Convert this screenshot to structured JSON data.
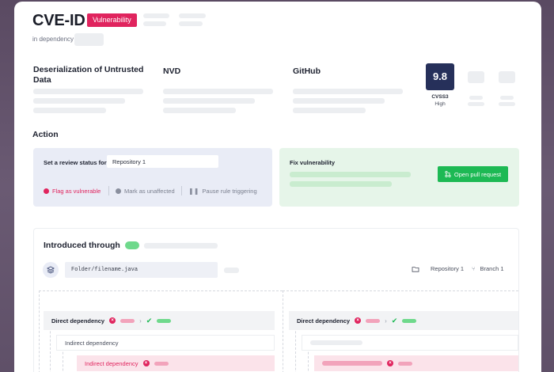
{
  "header": {
    "title": "CVE-ID",
    "badge": "Vulnerability",
    "subtitle": "in dependency"
  },
  "columns": [
    {
      "title": "Deserialization of Untrusted Data"
    },
    {
      "title": "NVD"
    },
    {
      "title": "GitHub"
    }
  ],
  "score": {
    "value": "9.8",
    "label": "CVSS3",
    "severity": "High"
  },
  "action": {
    "section_title": "Action",
    "review_label": "Set a review status for",
    "repo_value": "Repository 1",
    "flag_label": "Flag as vulnerable",
    "mark_label": "Mark as unaffected",
    "pause_label": "Pause rule triggering",
    "fix_label": "Fix vulnerability",
    "open_pr_label": "Open pull request"
  },
  "introduced": {
    "title": "Introduced through",
    "file_path": "Folder/filename.java",
    "repository": "Repository 1",
    "branch": "Branch 1",
    "left_tree": {
      "direct": "Direct dependency",
      "indirect": "Indirect dependency",
      "vulnerable": "Indirect dependency"
    },
    "right_tree": {
      "direct": "Direct dependency"
    }
  },
  "colors": {
    "accent": "#e0245e",
    "success": "#1db954",
    "score_bg": "#26305a"
  }
}
